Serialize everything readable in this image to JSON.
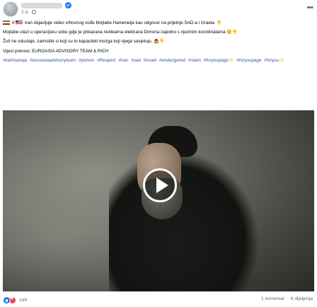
{
  "post": {
    "time": "2 d.",
    "more_icon": "more-horizontal-icon",
    "paragraphs": [
      "Iran objavljuje video vrhovnog vođe Mojtabe Hameneija kao odgovor na prijetnje SAD-a i Izraela. 👇",
      "Mojtabe ulazi u operacijsku sobu gdje je prikazana nuklearna elektrana Dimona zajedno s njezinim koordinatama 😌👇",
      "Žuti ne odustaje, zamislite si koji su to kapaciteti mozga koji njega savjetuju. 🙇👇",
      "Vijest prenosi: EUROASIA ADVISORY TEAM & RICH"
    ],
    "hashtags": [
      "#karlosaraja",
      "#euroasiaadvisoryteam",
      "#yemen",
      "#Respect",
      "#iran",
      "#sad",
      "#israel",
      "#endangered",
      "#islam",
      "#foryoupage✨",
      "#foryoupage",
      "#foryou✨"
    ]
  },
  "video": {
    "play_icon": "play-icon"
  },
  "footer": {
    "reaction_count": "149",
    "comments": "1 komentar",
    "shares": "8 dijeljenja"
  },
  "colors": {
    "accent": "#1877f2",
    "hashtag": "#385898",
    "muted": "#65676b"
  }
}
